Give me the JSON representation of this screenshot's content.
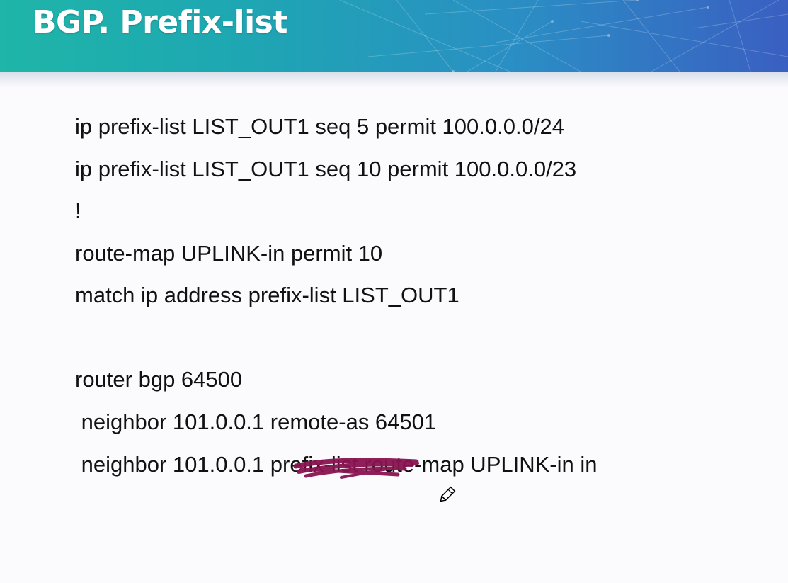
{
  "slide": {
    "title": "BGP. Prefix-list"
  },
  "code": {
    "lines": [
      "ip prefix-list LIST_OUT1 seq 5 permit 100.0.0.0/24",
      "ip prefix-list LIST_OUT1 seq 10 permit 100.0.0.0/23",
      "!",
      "route-map UPLINK-in permit 10",
      "match ip address prefix-list LIST_OUT1",
      "router bgp 64500",
      " neighbor 101.0.0.1 remote-as 64501",
      " neighbor 101.0.0.1 prefix-list route-map UPLINK-in in"
    ]
  },
  "annotation": {
    "scribble_color": "#8a1450",
    "struck_text": "prefix-list"
  },
  "colors": {
    "header_start": "#1fb5a8",
    "header_end": "#3a5fc2",
    "text": "#111111",
    "background": "#fbfafd"
  },
  "icons": {
    "cursor": "pencil-cursor-icon"
  }
}
